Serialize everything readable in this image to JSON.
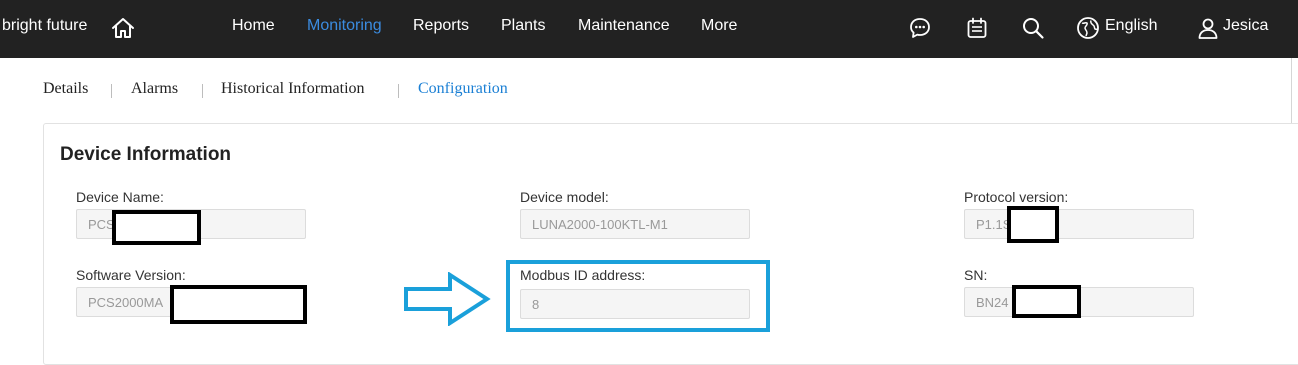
{
  "header": {
    "brand": "bright future",
    "nav": [
      {
        "label": "Home",
        "active": false
      },
      {
        "label": "Monitoring",
        "active": true
      },
      {
        "label": "Reports",
        "active": false
      },
      {
        "label": "Plants",
        "active": false
      },
      {
        "label": "Maintenance",
        "active": false
      },
      {
        "label": "More",
        "active": false
      }
    ],
    "icons": [
      "home-icon",
      "chat-icon",
      "calendar-icon",
      "search-icon",
      "globe-icon",
      "user-icon"
    ],
    "language": "English",
    "user": "Jesica"
  },
  "tabs": [
    {
      "label": "Details",
      "active": false
    },
    {
      "label": "Alarms",
      "active": false
    },
    {
      "label": "Historical Information",
      "active": false
    },
    {
      "label": "Configuration",
      "active": true
    }
  ],
  "device_info": {
    "title": "Device Information",
    "fields": {
      "device_name": {
        "label": "Device Name:",
        "value": "PCS"
      },
      "device_model": {
        "label": "Device model:",
        "value": "LUNA2000-100KTL-M1"
      },
      "protocol_version": {
        "label": "Protocol version:",
        "value": "P1.1S"
      },
      "software_version": {
        "label": "Software Version:",
        "value": "PCS2000MA"
      },
      "modbus_id": {
        "label": "Modbus ID address:",
        "value": "8"
      },
      "sn": {
        "label": "SN:",
        "value": "BN24"
      }
    }
  },
  "colors": {
    "topbar_bg": "#222222",
    "nav_active": "#3b8ce0",
    "tab_active": "#1a7fd4",
    "highlight": "#1aa0da",
    "redaction": "#000000"
  }
}
